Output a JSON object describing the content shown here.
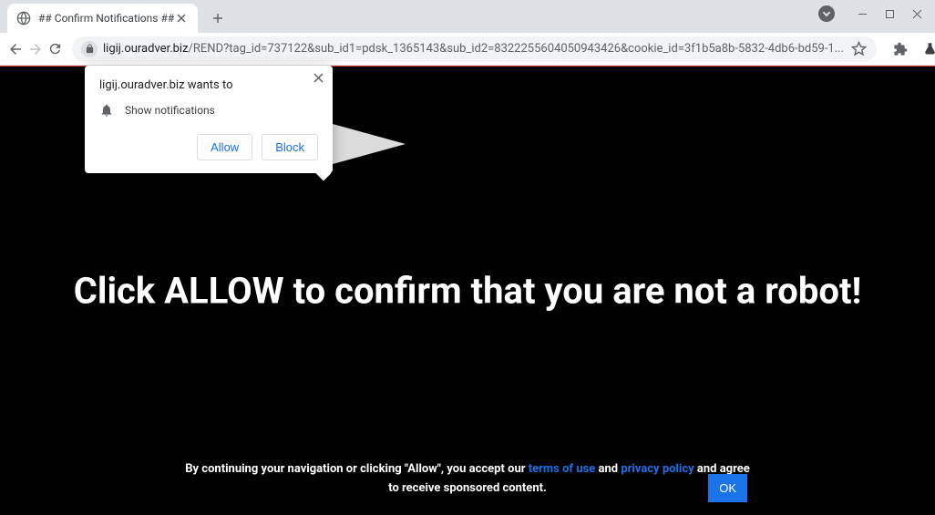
{
  "tab": {
    "title": "## Confirm Notifications ##"
  },
  "url": {
    "domain": "ligij.ouradver.biz",
    "path": "/REND?tag_id=737122&sub_id1=pdsk_1365143&sub_id2=8322255604050943426&cookie_id=3f1b5a8b-5832-4db6-bd59-1..."
  },
  "permission": {
    "origin_wants": "ligij.ouradver.biz wants to",
    "show_notifications": "Show notifications",
    "allow": "Allow",
    "block": "Block"
  },
  "page": {
    "headline": "Click ALLOW to confirm that you are not a robot!",
    "footer_prefix": "By continuing your navigation or clicking \"Allow\", you accept our ",
    "terms": "terms of use",
    "and": " and ",
    "privacy": "privacy policy",
    "footer_suffix": " and agree",
    "footer_line2": "to receive sponsored content.",
    "ok": "OK"
  }
}
